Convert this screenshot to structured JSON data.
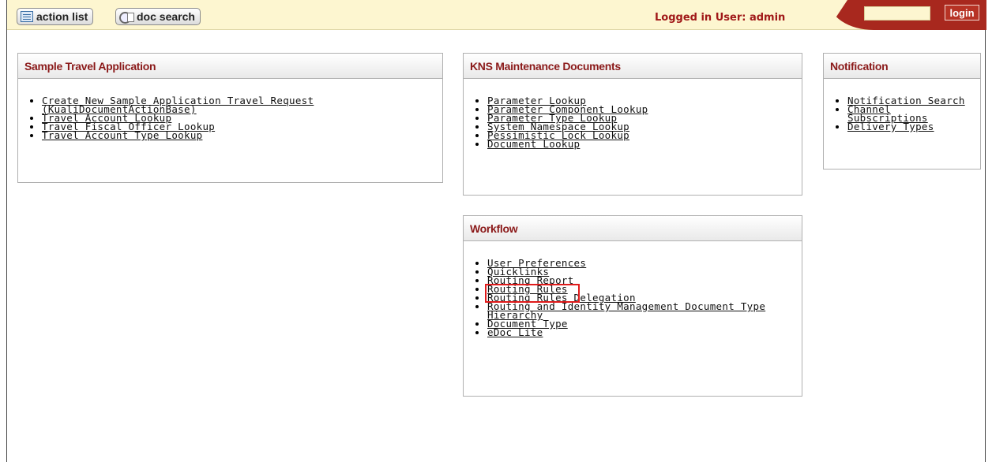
{
  "topbar": {
    "action_list_label": "action list",
    "doc_search_label": "doc search",
    "logged_in": "Logged in User: admin",
    "login_label": "login",
    "login_value": ""
  },
  "panels": {
    "travel": {
      "title": "Sample Travel Application",
      "links": [
        "Create New Sample Application Travel Request (KualiDocumentActionBase)",
        "Travel Account Lookup",
        "Travel Fiscal Officer Lookup",
        "Travel Account Type Lookup"
      ]
    },
    "kns": {
      "title": "KNS Maintenance Documents",
      "links": [
        "Parameter Lookup",
        "Parameter Component Lookup",
        "Parameter Type Lookup",
        "System Namespace Lookup",
        "Pessimistic Lock Lookup",
        "Document Lookup"
      ]
    },
    "notification": {
      "title": "Notification",
      "links": [
        "Notification Search",
        "Channel Subscriptions",
        "Delivery Types"
      ]
    },
    "workflow": {
      "title": "Workflow",
      "links": [
        "User Preferences",
        "Quicklinks",
        "Routing Report",
        "Routing Rules",
        "Routing Rules Delegation",
        "Routing and Identity Management Document Type Hierarchy",
        "Document Type",
        "eDoc Lite"
      ]
    }
  },
  "colors": {
    "topbar_bg": "#fdf6d0",
    "brand_red": "#a8281e",
    "title_red": "#8b1a1a",
    "highlight": "#e01b1b"
  },
  "icons": [
    "list-icon",
    "document-search-icon"
  ]
}
